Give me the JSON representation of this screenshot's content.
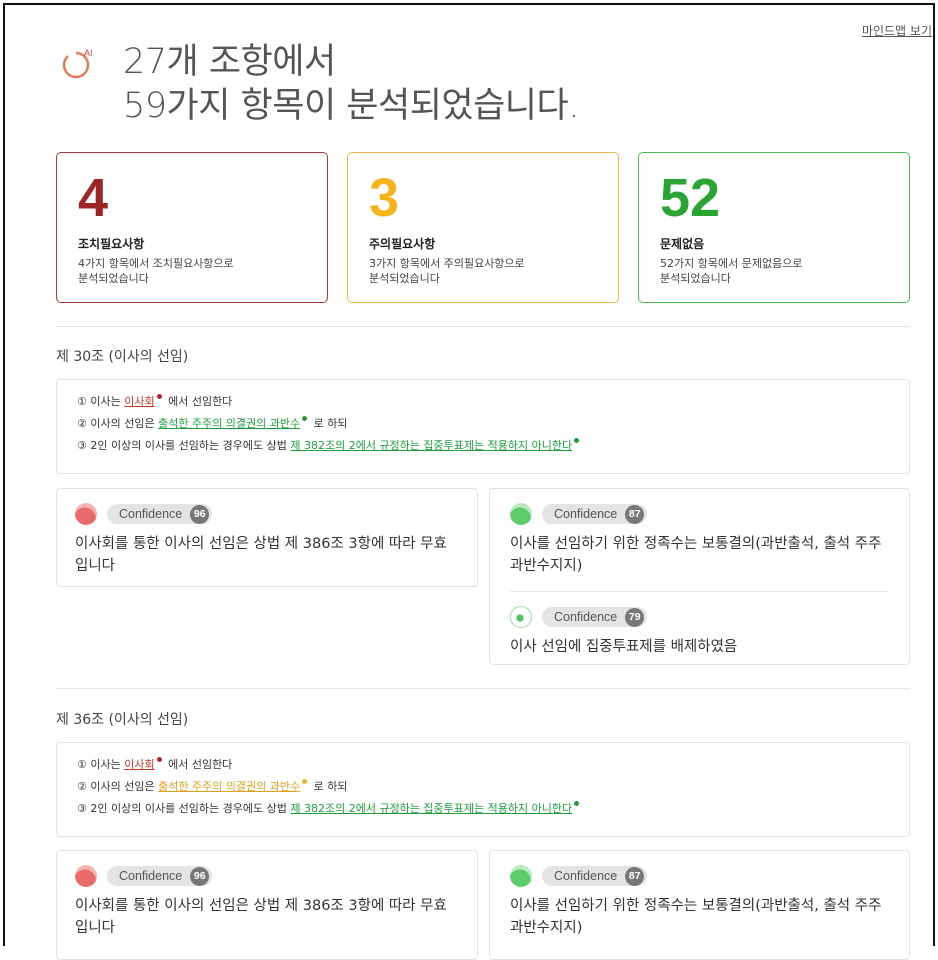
{
  "header": {
    "mindmap_link": "마인드맵 보기",
    "ai_icon_label": "AI",
    "title_line1": "27개 조항에서",
    "title_line2": "59가지 항목이 분석되었습니다."
  },
  "stats": [
    {
      "value": "4",
      "label": "조치필요사항",
      "desc1": "4가지 항목에서 조치필요사항으로",
      "desc2": "분석되었습니다",
      "color": "#9b2424"
    },
    {
      "value": "3",
      "label": "주의필요사항",
      "desc1": "3가지 항목에서 주의필요사항으로",
      "desc2": "분석되었습니다",
      "color": "#f6b41c"
    },
    {
      "value": "52",
      "label": "문제없음",
      "desc1": "52가지 항목에서 문제없음으로",
      "desc2": "분석되었습니다",
      "color": "#2aa534"
    }
  ],
  "sections": [
    {
      "title": "제 30조 (이사의 선임)",
      "clause": {
        "l1_pre": "① 이사는 ",
        "l1_link": "이사회",
        "l1_post": " 에서 선임한다",
        "l2_pre": "② 이사의 선임은 ",
        "l2_link": "출석한 주주의 의결권의 과반수",
        "l2_post": " 로 하되",
        "l3_pre": "③ 2인 이상의 이사를 선임하는 경우에도 상법 ",
        "l3_link": "제 382조의 2에서 규정하는 집중투표제는 적용하지 아니한다"
      },
      "left_card": {
        "confidence_label": "Confidence",
        "score": "96",
        "text": "이사회를 통한 이사의 선임은 상법 제 386조 3항에 따라 무효 입니다"
      },
      "right_card": {
        "item1": {
          "confidence_label": "Confidence",
          "score": "87",
          "text": "이사를 선임하기 위한 정족수는 보통결의(과반출석, 출석 주주 과반수지지)"
        },
        "item2": {
          "confidence_label": "Confidence",
          "score": "79",
          "text": "이사 선임에 집중투표제를 배제하였음"
        }
      }
    },
    {
      "title": "제 36조 (이사의 선임)",
      "clause": {
        "l1_pre": "① 이사는 ",
        "l1_link": "이사회",
        "l1_post": " 에서 선임한다",
        "l2_pre": "② 이사의 선임은 ",
        "l2_link": "출석한 주주의 의결권의 과반수",
        "l2_post": " 로 하되",
        "l3_pre": "③ 2인 이상의 이사를 선임하는 경우에도 상법 ",
        "l3_link": "제 382조의 2에서 규정하는 집중투표제는 적용하지 아니한다"
      },
      "left_card": {
        "confidence_label": "Confidence",
        "score": "96",
        "text": "이사회를 통한 이사의 선임은 상법 제 386조 3항에 따라 무효 입니다"
      },
      "right_card": {
        "item1": {
          "confidence_label": "Confidence",
          "score": "87",
          "text": "이사를 선임하기 위한 정족수는 보통결의(과반출석, 출석 주주 과반수지지)"
        }
      }
    }
  ]
}
